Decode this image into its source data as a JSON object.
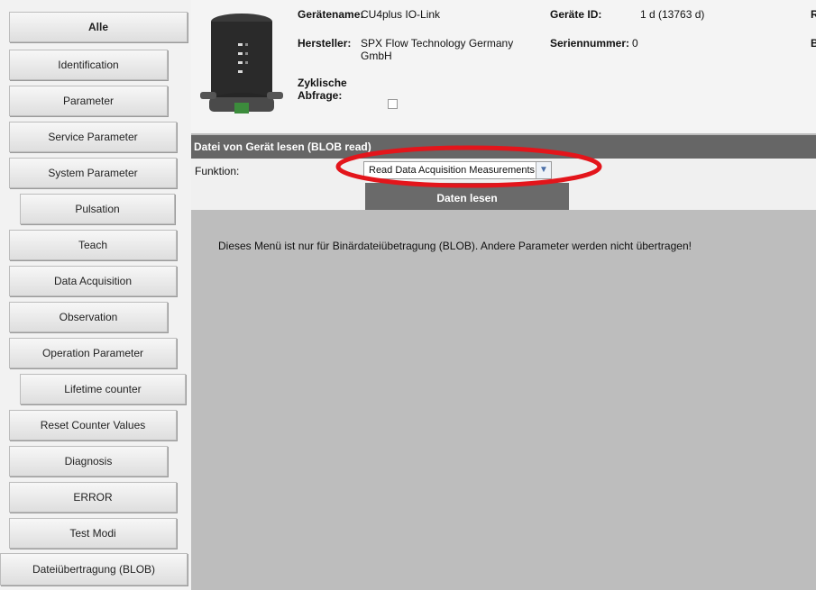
{
  "sidebar": {
    "items": [
      {
        "label": "Alle"
      },
      {
        "label": "Identification"
      },
      {
        "label": "Parameter"
      },
      {
        "label": "Service Parameter"
      },
      {
        "label": "System Parameter"
      },
      {
        "label": "Pulsation"
      },
      {
        "label": "Teach"
      },
      {
        "label": "Data Acquisition"
      },
      {
        "label": "Observation"
      },
      {
        "label": "Operation Parameter"
      },
      {
        "label": "Lifetime counter"
      },
      {
        "label": "Reset Counter Values"
      },
      {
        "label": "Diagnosis"
      },
      {
        "label": "ERROR"
      },
      {
        "label": "Test Modi"
      },
      {
        "label": "Dateiübertragung (BLOB)"
      }
    ]
  },
  "device": {
    "name_label": "Gerätename:",
    "name_value": "CU4plus IO-Link",
    "manufacturer_label": "Hersteller:",
    "manufacturer_value_line1": "SPX Flow Technology Germany",
    "manufacturer_value_line2": "GmbH",
    "cyclic_label_line1": "Zyklische",
    "cyclic_label_line2": "Abfrage:",
    "device_id_label": "Geräte ID:",
    "device_id_value": "1 d (13763 d)",
    "serial_label": "Seriennummer:",
    "serial_value": "0",
    "cut_label_1": "R",
    "cut_label_2": "B"
  },
  "blob": {
    "title": "Datei von Gerät lesen (BLOB read)",
    "function_label": "Funktion:",
    "function_value": "Read Data Acquisition Measurements",
    "read_button": "Daten lesen",
    "info": "Dieses Menü ist nur für Binärdateiübetragung (BLOB). Andere Parameter werden nicht übertragen!"
  },
  "colors": {
    "panel_header": "#666666",
    "highlight_ellipse": "#e3151b",
    "background": "#bdbdbd"
  }
}
